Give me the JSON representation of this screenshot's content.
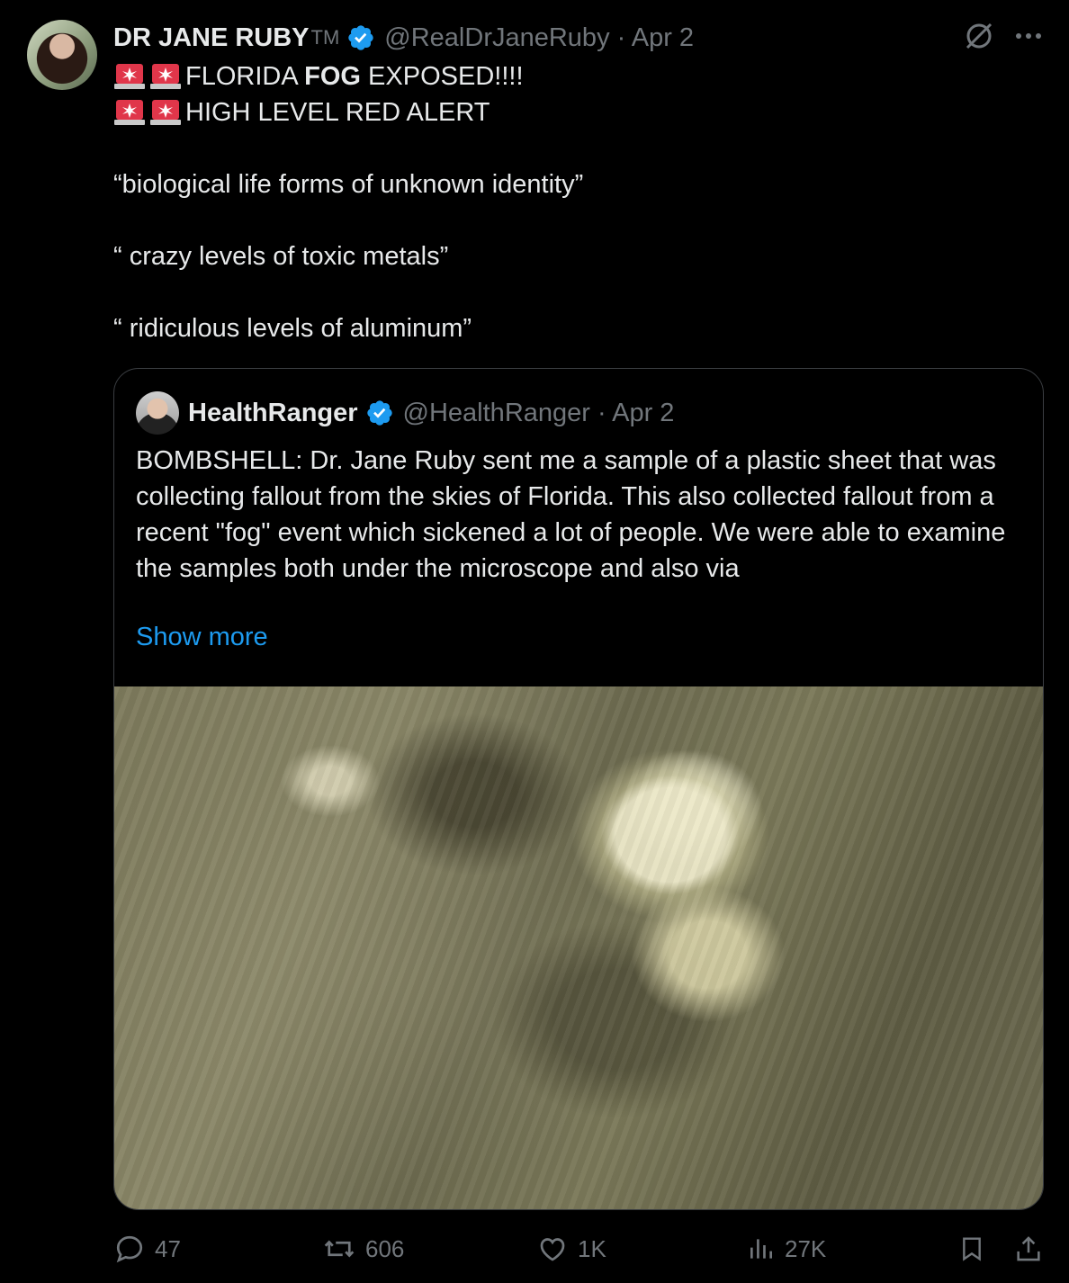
{
  "tweet": {
    "author_name": "DR JANE RUBY",
    "author_suffix": "TM",
    "author_handle_date": "@RealDrJaneRuby · Apr 2",
    "line1_pre": "FLORIDA ",
    "line1_bold": "FOG",
    "line1_post": " EXPOSED!!!!",
    "line2": "HIGH LEVEL RED ALERT",
    "line3": "“biological life forms of unknown identity”",
    "line4": "“ crazy levels of toxic metals”",
    "line5": "“ ridiculous levels of aluminum”",
    "emoji_icon": "rotating-light-icon"
  },
  "quoted": {
    "author_name": "HealthRanger",
    "author_handle_date": "@HealthRanger · Apr 2",
    "body": "BOMBSHELL: Dr. Jane Ruby sent me a sample of a plastic sheet that was collecting fallout from the skies of Florida. This also collected fallout from a recent \"fog\" event which sickened a lot of people. We were able to examine the samples both under the microscope and also via",
    "show_more": "Show more"
  },
  "actions": {
    "replies": "47",
    "reposts": "606",
    "likes": "1K",
    "views": "27K"
  },
  "colors": {
    "background": "#000000",
    "text": "#e7e9ea",
    "muted": "#71767b",
    "accent": "#1d9bf0",
    "border": "#3a3d41"
  }
}
